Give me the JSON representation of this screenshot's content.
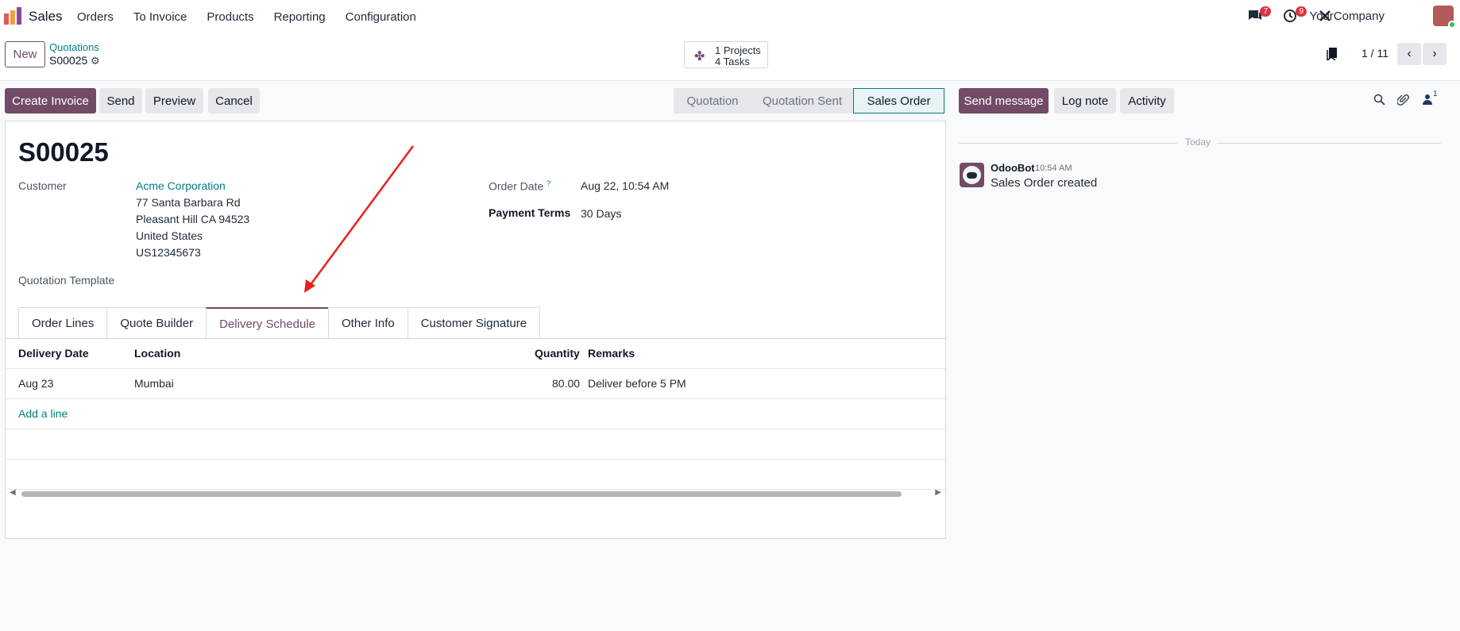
{
  "app": {
    "name": "Sales"
  },
  "menu": [
    "Orders",
    "To Invoice",
    "Products",
    "Reporting",
    "Configuration"
  ],
  "systray": {
    "messages_count": "7",
    "activities_count": "9",
    "company": "YourCompany"
  },
  "control": {
    "new_label": "New",
    "breadcrumb_parent": "Quotations",
    "breadcrumb_current": "S00025",
    "smart_button": {
      "line1": "1 Projects",
      "line2": "4 Tasks"
    },
    "pager": "1 / 11"
  },
  "actions": [
    "Create Invoice",
    "Send",
    "Preview",
    "Cancel"
  ],
  "stages": [
    "Quotation",
    "Quotation Sent",
    "Sales Order"
  ],
  "record": {
    "name": "S00025",
    "customer_label": "Customer",
    "customer_name": "Acme Corporation",
    "address": [
      "77 Santa Barbara Rd",
      "Pleasant Hill CA 94523",
      "United States",
      "US12345673"
    ],
    "template_label": "Quotation Template",
    "order_date_label": "Order Date",
    "order_date_help": "?",
    "order_date": "Aug 22, 10:54 AM",
    "payment_terms_label": "Payment Terms",
    "payment_terms": "30 Days"
  },
  "tabs": [
    "Order Lines",
    "Quote Builder",
    "Delivery Schedule",
    "Other Info",
    "Customer Signature"
  ],
  "table": {
    "headers": [
      "Delivery Date",
      "Location",
      "Quantity",
      "Remarks"
    ],
    "rows": [
      [
        "Aug 23",
        "Mumbai",
        "80.00",
        "Deliver before 5 PM"
      ]
    ],
    "add_line": "Add a line"
  },
  "chatter": {
    "buttons": [
      "Send message",
      "Log note",
      "Activity"
    ],
    "followers_count": "1",
    "date_separator": "Today",
    "messages": [
      {
        "author": "OdooBot",
        "time": "10:54 AM",
        "body": "Sales Order created"
      }
    ]
  },
  "colors": {
    "primary": "#714b67",
    "link": "#017e84",
    "badge": "#dc3545"
  },
  "annotation": {
    "type": "red-arrow",
    "color": "#e8211e"
  }
}
